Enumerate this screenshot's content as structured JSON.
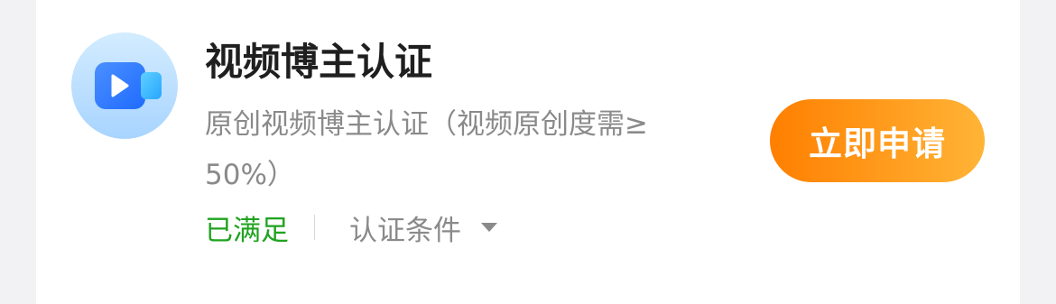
{
  "card": {
    "icon": "video-camera-icon",
    "title": "视频博主认证",
    "description": "原创视频博主认证（视频原创度需≥50%）",
    "status": "已满足",
    "conditions_label": "认证条件",
    "apply_button": "立即申请"
  },
  "colors": {
    "status_green": "#1fa31f",
    "button_gradient_start": "#ff7f00",
    "button_gradient_end": "#ffb436",
    "icon_blue": "#2f7bff"
  }
}
